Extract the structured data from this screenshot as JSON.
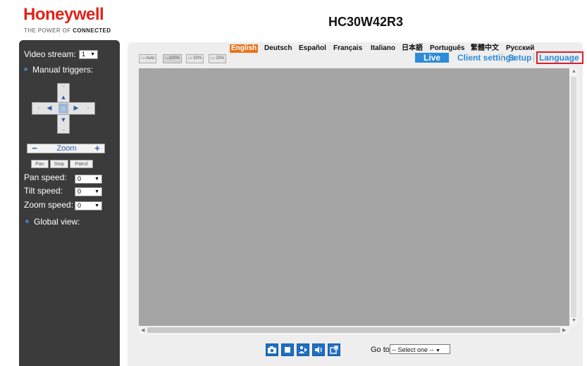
{
  "header": {
    "logo_text": "Honeywell",
    "tagline_pre": "THE POWER OF ",
    "tagline_bold": "CONNECTED",
    "model": "HC30W42R3"
  },
  "sidebar": {
    "video_stream_label": "Video stream:",
    "video_stream_value": "1",
    "manual_triggers_label": "Manual triggers:",
    "zoom_label": "Zoom",
    "zoom_minus": "−",
    "zoom_plus": "+",
    "buttons": [
      "Pan",
      "Stop",
      "Patrol"
    ],
    "pan_speed_label": "Pan speed:",
    "pan_speed_value": "0",
    "tilt_speed_label": "Tilt speed:",
    "tilt_speed_value": "0",
    "zoom_speed_label": "Zoom speed:",
    "zoom_speed_value": "0",
    "global_view_label": "Global view:"
  },
  "viewer": {
    "size_buttons": [
      "Auto",
      "100%",
      "50%",
      "25%"
    ],
    "languages": [
      "English",
      "Deutsch",
      "Español",
      "Français",
      "Italiano",
      "日本語",
      "Português",
      "繁體中文",
      "Русский"
    ],
    "selected_language": "English",
    "nav": {
      "live": "Live",
      "client_settings": "Client settings",
      "setup": "Setup",
      "language": "Language"
    },
    "goto_label": "Go to",
    "goto_select": "-- Select one --",
    "toolbar_icons": [
      "camera-icon",
      "record-icon",
      "person-icon",
      "speaker-icon",
      "popout-icon"
    ]
  },
  "colors": {
    "brand_red": "#e2231a",
    "sidebar_bg": "#3b3b3b",
    "nav_blue": "#2d8bd8",
    "selected_lang_bg": "#e8751a",
    "highlight_box": "#d8202a",
    "video_bg": "#a5a5a5"
  }
}
